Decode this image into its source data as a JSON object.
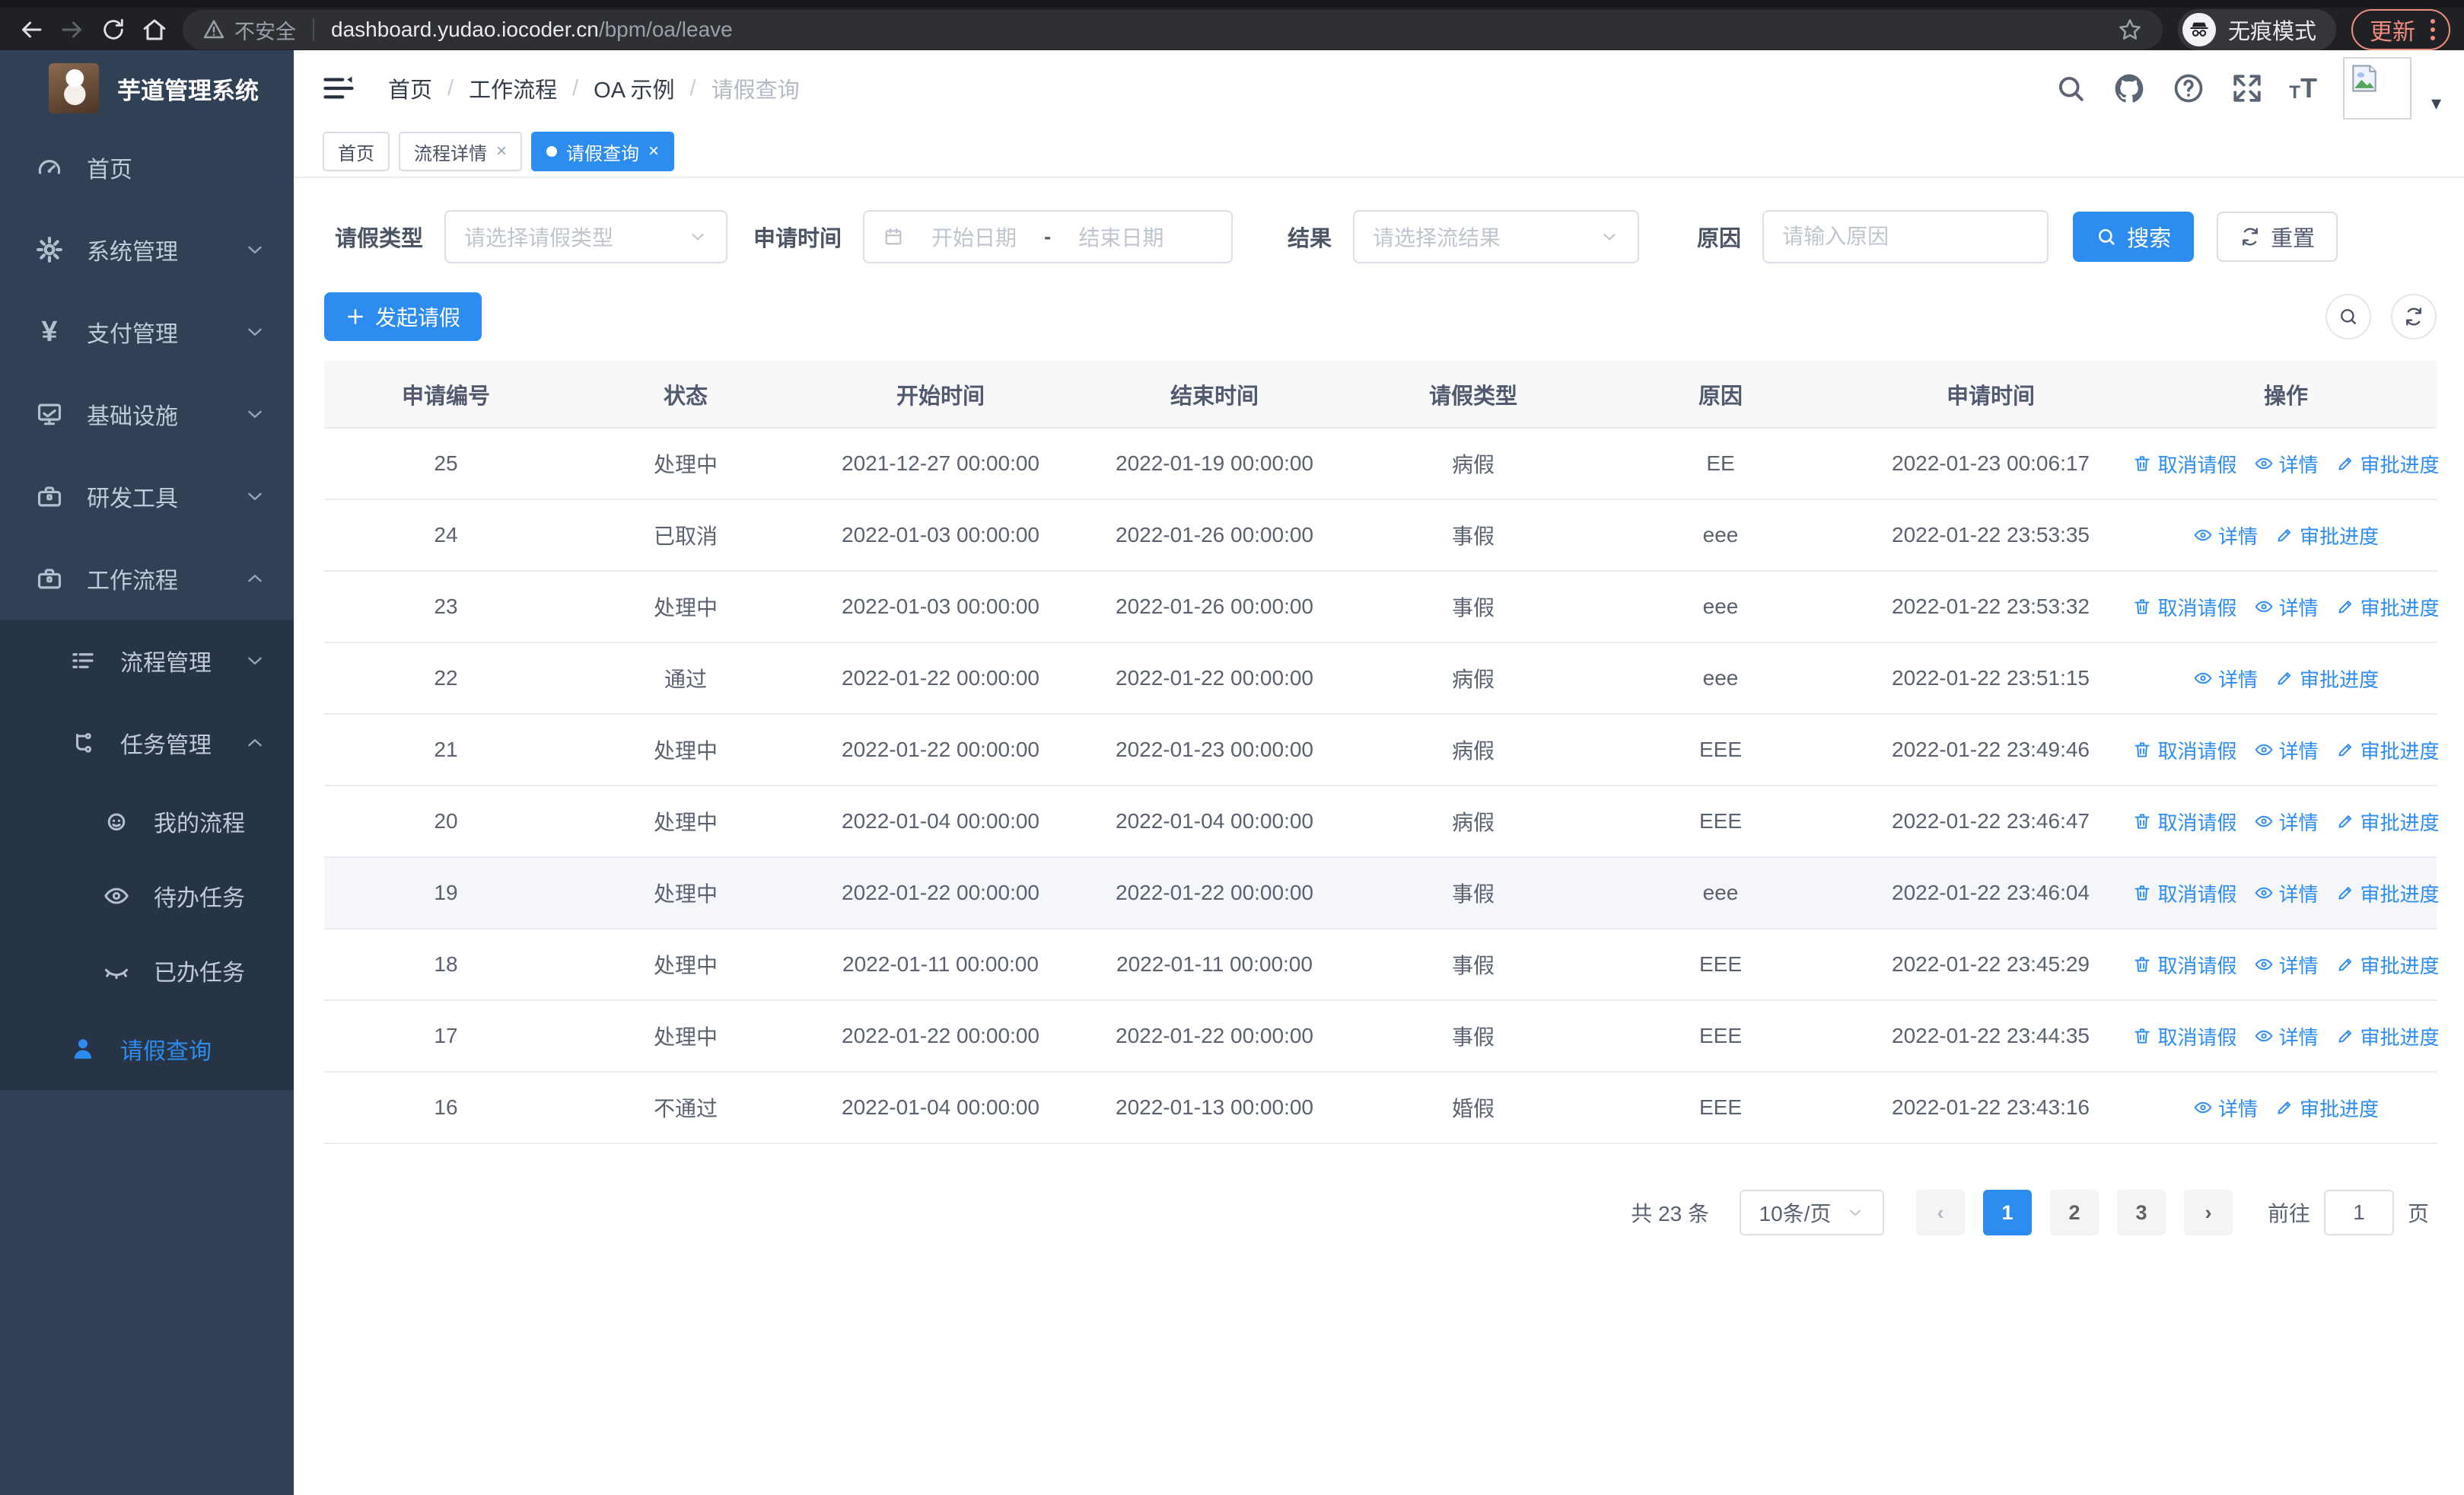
{
  "browser": {
    "security_label": "不安全",
    "url_host": "dashboard.yudao.iocoder.cn",
    "url_path": "/bpm/oa/leave",
    "incognito_label": "无痕模式",
    "update_label": "更新"
  },
  "sidebar": {
    "title": "芋道管理系统",
    "items": [
      {
        "label": "首页"
      },
      {
        "label": "系统管理"
      },
      {
        "label": "支付管理"
      },
      {
        "label": "基础设施"
      },
      {
        "label": "研发工具"
      },
      {
        "label": "工作流程"
      },
      {
        "label": "流程管理"
      },
      {
        "label": "任务管理"
      },
      {
        "label": "我的流程"
      },
      {
        "label": "待办任务"
      },
      {
        "label": "已办任务"
      },
      {
        "label": "请假查询"
      }
    ]
  },
  "breadcrumb": {
    "items": [
      "首页",
      "工作流程",
      "OA 示例",
      "请假查询"
    ],
    "separator": "/"
  },
  "tabs": [
    {
      "label": "首页",
      "closable": false,
      "active": false
    },
    {
      "label": "流程详情",
      "closable": true,
      "active": false
    },
    {
      "label": "请假查询",
      "closable": true,
      "active": true
    }
  ],
  "filters": {
    "leave_type": {
      "label": "请假类型",
      "placeholder": "请选择请假类型"
    },
    "apply_time": {
      "label": "申请时间",
      "start_placeholder": "开始日期",
      "separator": "-",
      "end_placeholder": "结束日期"
    },
    "result": {
      "label": "结果",
      "placeholder": "请选择流结果"
    },
    "reason": {
      "label": "原因",
      "placeholder": "请输入原因"
    },
    "search_label": "搜索",
    "reset_label": "重置"
  },
  "toolbar": {
    "create_label": "发起请假"
  },
  "table": {
    "columns": [
      "申请编号",
      "状态",
      "开始时间",
      "结束时间",
      "请假类型",
      "原因",
      "申请时间",
      "操作"
    ],
    "action_labels": {
      "cancel": "取消请假",
      "detail": "详情",
      "progress": "审批进度"
    },
    "rows": [
      {
        "id": "25",
        "status": "处理中",
        "start": "2021-12-27 00:00:00",
        "end": "2022-01-19 00:00:00",
        "type": "病假",
        "reason": "EE",
        "applied": "2022-01-23 00:06:17",
        "actions": [
          "cancel",
          "detail",
          "progress"
        ]
      },
      {
        "id": "24",
        "status": "已取消",
        "start": "2022-01-03 00:00:00",
        "end": "2022-01-26 00:00:00",
        "type": "事假",
        "reason": "eee",
        "applied": "2022-01-22 23:53:35",
        "actions": [
          "detail",
          "progress"
        ]
      },
      {
        "id": "23",
        "status": "处理中",
        "start": "2022-01-03 00:00:00",
        "end": "2022-01-26 00:00:00",
        "type": "事假",
        "reason": "eee",
        "applied": "2022-01-22 23:53:32",
        "actions": [
          "cancel",
          "detail",
          "progress"
        ]
      },
      {
        "id": "22",
        "status": "通过",
        "start": "2022-01-22 00:00:00",
        "end": "2022-01-22 00:00:00",
        "type": "病假",
        "reason": "eee",
        "applied": "2022-01-22 23:51:15",
        "actions": [
          "detail",
          "progress"
        ]
      },
      {
        "id": "21",
        "status": "处理中",
        "start": "2022-01-22 00:00:00",
        "end": "2022-01-23 00:00:00",
        "type": "病假",
        "reason": "EEE",
        "applied": "2022-01-22 23:49:46",
        "actions": [
          "cancel",
          "detail",
          "progress"
        ]
      },
      {
        "id": "20",
        "status": "处理中",
        "start": "2022-01-04 00:00:00",
        "end": "2022-01-04 00:00:00",
        "type": "病假",
        "reason": "EEE",
        "applied": "2022-01-22 23:46:47",
        "actions": [
          "cancel",
          "detail",
          "progress"
        ]
      },
      {
        "id": "19",
        "status": "处理中",
        "start": "2022-01-22 00:00:00",
        "end": "2022-01-22 00:00:00",
        "type": "事假",
        "reason": "eee",
        "applied": "2022-01-22 23:46:04",
        "actions": [
          "cancel",
          "detail",
          "progress"
        ],
        "highlighted": true
      },
      {
        "id": "18",
        "status": "处理中",
        "start": "2022-01-11 00:00:00",
        "end": "2022-01-11 00:00:00",
        "type": "事假",
        "reason": "EEE",
        "applied": "2022-01-22 23:45:29",
        "actions": [
          "cancel",
          "detail",
          "progress"
        ]
      },
      {
        "id": "17",
        "status": "处理中",
        "start": "2022-01-22 00:00:00",
        "end": "2022-01-22 00:00:00",
        "type": "事假",
        "reason": "EEE",
        "applied": "2022-01-22 23:44:35",
        "actions": [
          "cancel",
          "detail",
          "progress"
        ]
      },
      {
        "id": "16",
        "status": "不通过",
        "start": "2022-01-04 00:00:00",
        "end": "2022-01-13 00:00:00",
        "type": "婚假",
        "reason": "EEE",
        "applied": "2022-01-22 23:43:16",
        "actions": [
          "detail",
          "progress"
        ]
      }
    ]
  },
  "pagination": {
    "total": "共 23 条",
    "page_size": "10条/页",
    "pages": [
      "1",
      "2",
      "3"
    ],
    "current": "1",
    "goto_label": "前往",
    "goto_value": "1",
    "goto_unit": "页"
  },
  "colors": {
    "primary": "#2d8cf0",
    "sidebar_bg": "#304156",
    "submenu_bg": "#263445",
    "chrome_bg": "#202124"
  }
}
